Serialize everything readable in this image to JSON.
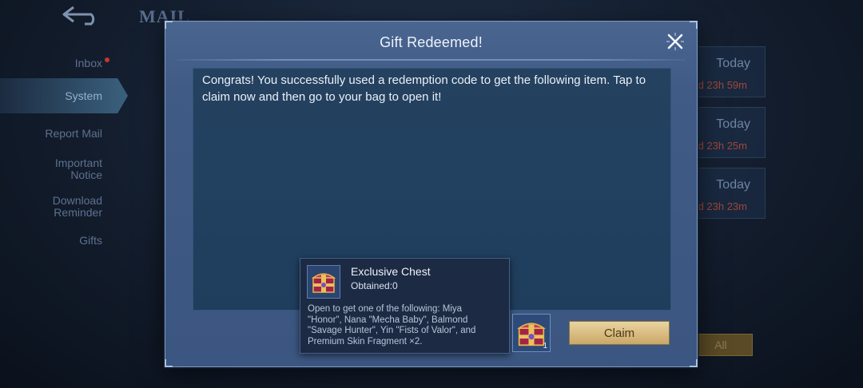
{
  "background": {
    "title": "MAIL",
    "nav": [
      {
        "label": "Inbox"
      },
      {
        "label": "System"
      },
      {
        "label": "Report Mail"
      },
      {
        "label": "Important Notice"
      },
      {
        "label": "Download Reminder"
      },
      {
        "label": "Gifts"
      }
    ],
    "mails": [
      {
        "date": "Today",
        "expire": "d 23h 59m"
      },
      {
        "date": "Today",
        "expire": "d 23h 25m"
      },
      {
        "date": "Today",
        "expire": "d 23h 23m"
      }
    ],
    "claim_all_label": "All"
  },
  "modal": {
    "title": "Gift Redeemed!",
    "message": "Congrats! You successfully used a redemption code to get the following item. Tap to claim now and then go to your bag to open it!",
    "tooltip": {
      "item_name": "Exclusive Chest",
      "obtained": "Obtained:0",
      "description": "Open to get one of the following: Miya \"Honor\", Nana \"Mecha Baby\", Balmond \"Savage Hunter\", Yin \"Fists of Valor\", and Premium Skin Fragment ×2."
    },
    "item": {
      "icon": "chest-icon",
      "count": "1"
    },
    "claim_label": "Claim"
  },
  "colors": {
    "accent_gold": "#d8bb80",
    "modal_bg": "#3f5b86",
    "expire_red": "#a04638"
  }
}
